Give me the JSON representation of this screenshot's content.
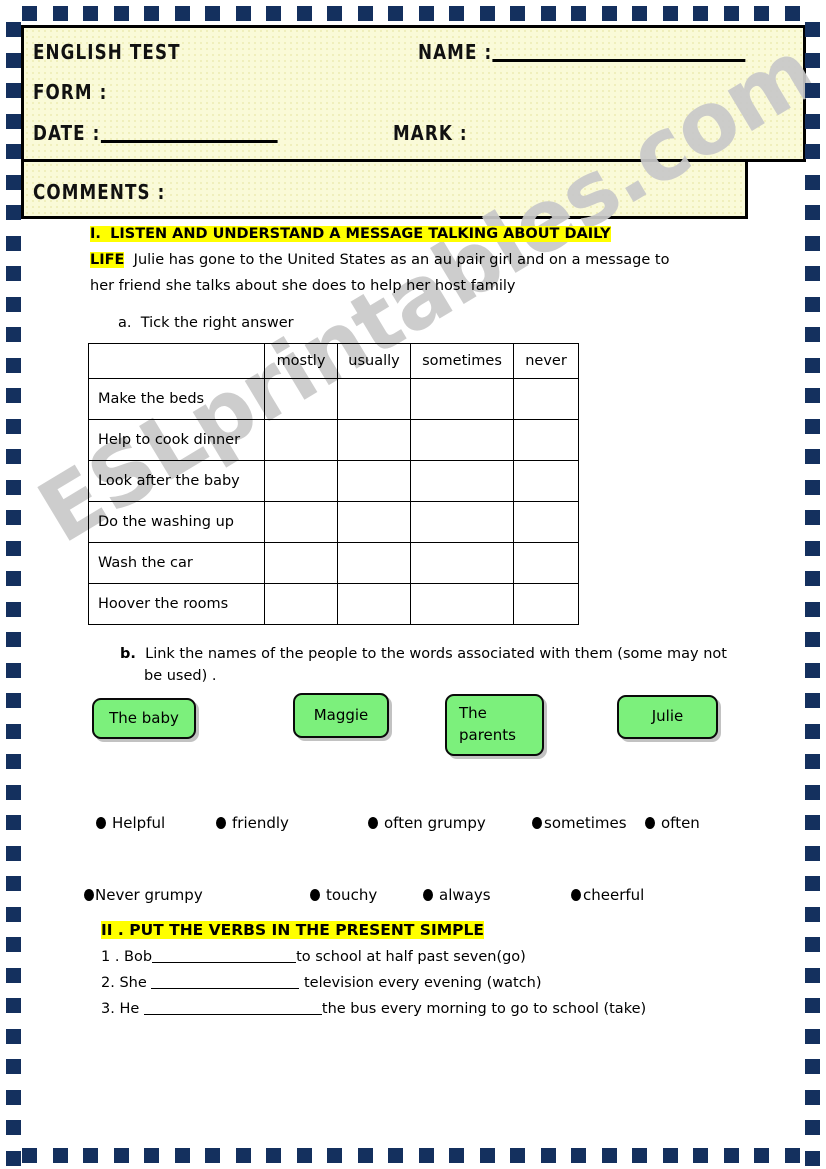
{
  "header": {
    "title": "ENGLISH TEST",
    "name_label": "NAME :",
    "form_label": "FORM :",
    "date_label": "DATE :",
    "mark_label": "MARK :",
    "comments_label": "COMMENTS :"
  },
  "section_one": {
    "number": "I.",
    "heading": "LISTEN AND UNDERSTAND  A MESSAGE TALKING  ABOUT DAILY",
    "heading_cont": "LIFE",
    "intro_line1": "Julie has gone to the United States as an au pair girl and  on a message to",
    "intro_line2": "her friend she talks about she does  to help her host family",
    "task_a_label": "a.",
    "task_a_text": "Tick the right answer",
    "task_b_label": "b.",
    "task_b_line1": "Link  the names of the people to the words associated with them (some may not",
    "task_b_line2": "be used) ."
  },
  "tick_table": {
    "columns": [
      "",
      "mostly",
      "usually",
      "sometimes",
      "never"
    ],
    "rows": [
      "Make the beds",
      "Help to cook dinner",
      "Look after the baby",
      "Do the washing up",
      "Wash the car",
      "Hoover the rooms"
    ]
  },
  "people_boxes": [
    {
      "label": "The baby"
    },
    {
      "label": "Maggie"
    },
    {
      "label": "The parents"
    },
    {
      "label": "Julie"
    }
  ],
  "word_bank_row1": [
    "Helpful",
    "friendly",
    "often grumpy",
    "sometimes",
    "often"
  ],
  "word_bank_row2": [
    "Never grumpy",
    "touchy",
    "always",
    "cheerful"
  ],
  "section_two": {
    "heading": "II . PUT THE VERBS IN THE PRESENT SIMPLE",
    "items": [
      {
        "prefix": "1 . Bob",
        "suffix": "to school at half past seven(go)"
      },
      {
        "prefix": "2. She ",
        "suffix": " television every evening (watch)"
      },
      {
        "prefix": "3. He ",
        "suffix": "the bus every morning to go to school (take)"
      }
    ]
  },
  "watermark": {
    "text": "ESLprintables.com"
  },
  "colors": {
    "border_square": "#14305e",
    "header_bg": "#fafad8",
    "highlight": "#ffff00",
    "box_green": "#7cf07c"
  }
}
